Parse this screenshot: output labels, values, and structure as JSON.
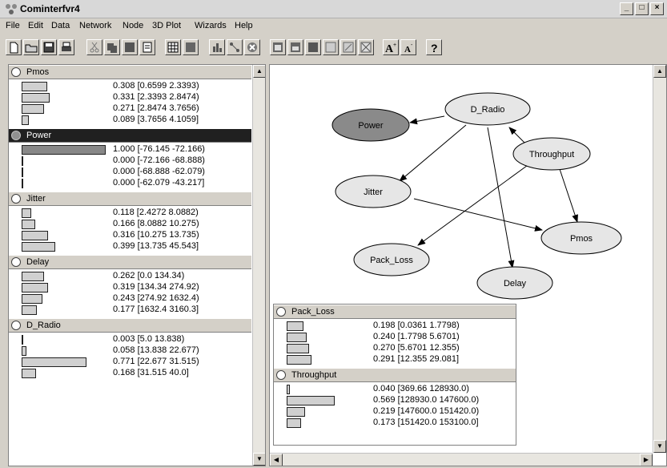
{
  "window": {
    "title": "Cominterfvr4",
    "controls": [
      "_",
      "□",
      "×"
    ]
  },
  "menu": [
    "File",
    "Edit",
    "Data",
    "Network",
    "Node",
    "3D Plot",
    "Wizards",
    "Help"
  ],
  "left_nodes": [
    {
      "name": "Pmos",
      "selected": false,
      "states": [
        {
          "p": 0.308,
          "label": "0.308  [0.6599 2.3393)"
        },
        {
          "p": 0.331,
          "label": "0.331  [2.3393 2.8474)"
        },
        {
          "p": 0.271,
          "label": "0.271  [2.8474 3.7656)"
        },
        {
          "p": 0.089,
          "label": "0.089  [3.7656 4.1059]"
        }
      ]
    },
    {
      "name": "Power",
      "selected": true,
      "states": [
        {
          "p": 1.0,
          "label": "1.000  [-76.145 -72.166)"
        },
        {
          "p": 0.0,
          "label": "0.000  [-72.166 -68.888)"
        },
        {
          "p": 0.0,
          "label": "0.000  [-68.888 -62.079)"
        },
        {
          "p": 0.0,
          "label": "0.000  [-62.079 -43.217]"
        }
      ]
    },
    {
      "name": "Jitter",
      "selected": false,
      "states": [
        {
          "p": 0.118,
          "label": "0.118  [2.4272 8.0882)"
        },
        {
          "p": 0.166,
          "label": "0.166  [8.0882 10.275)"
        },
        {
          "p": 0.316,
          "label": "0.316  [10.275 13.735)"
        },
        {
          "p": 0.399,
          "label": "0.399  [13.735 45.543]"
        }
      ]
    },
    {
      "name": "Delay",
      "selected": false,
      "states": [
        {
          "p": 0.262,
          "label": "0.262  [0.0 134.34)"
        },
        {
          "p": 0.319,
          "label": "0.319  [134.34 274.92)"
        },
        {
          "p": 0.243,
          "label": "0.243  [274.92 1632.4)"
        },
        {
          "p": 0.177,
          "label": "0.177  [1632.4 3160.3]"
        }
      ]
    },
    {
      "name": "D_Radio",
      "selected": false,
      "states": [
        {
          "p": 0.003,
          "label": "0.003  [5.0 13.838)"
        },
        {
          "p": 0.058,
          "label": "0.058  [13.838 22.677)"
        },
        {
          "p": 0.771,
          "label": "0.771  [22.677 31.515)"
        },
        {
          "p": 0.168,
          "label": "0.168  [31.515 40.0]"
        }
      ]
    }
  ],
  "right_nodes": [
    {
      "name": "Pack_Loss",
      "selected": false,
      "states": [
        {
          "p": 0.198,
          "label": "0.198  [0.0361 1.7798)"
        },
        {
          "p": 0.24,
          "label": "0.240  [1.7798 5.6701)"
        },
        {
          "p": 0.27,
          "label": "0.270  [5.6701 12.355)"
        },
        {
          "p": 0.291,
          "label": "0.291  [12.355 29.081]"
        }
      ]
    },
    {
      "name": "Throughput",
      "selected": false,
      "states": [
        {
          "p": 0.04,
          "label": "0.040  [369.66 128930.0)"
        },
        {
          "p": 0.569,
          "label": "0.569  [128930.0 147600.0)"
        },
        {
          "p": 0.219,
          "label": "0.219  [147600.0 151420.0)"
        },
        {
          "p": 0.173,
          "label": "0.173  [151420.0 153100.0]"
        }
      ]
    }
  ],
  "graph_nodes": [
    {
      "id": "d_radio",
      "label": "D_Radio",
      "shaded": false
    },
    {
      "id": "power",
      "label": "Power",
      "shaded": true
    },
    {
      "id": "throughput",
      "label": "Throughput",
      "shaded": false
    },
    {
      "id": "jitter",
      "label": "Jitter",
      "shaded": false
    },
    {
      "id": "pmos",
      "label": "Pmos",
      "shaded": false
    },
    {
      "id": "pack_loss",
      "label": "Pack_Loss",
      "shaded": false
    },
    {
      "id": "delay",
      "label": "Delay",
      "shaded": false
    }
  ]
}
